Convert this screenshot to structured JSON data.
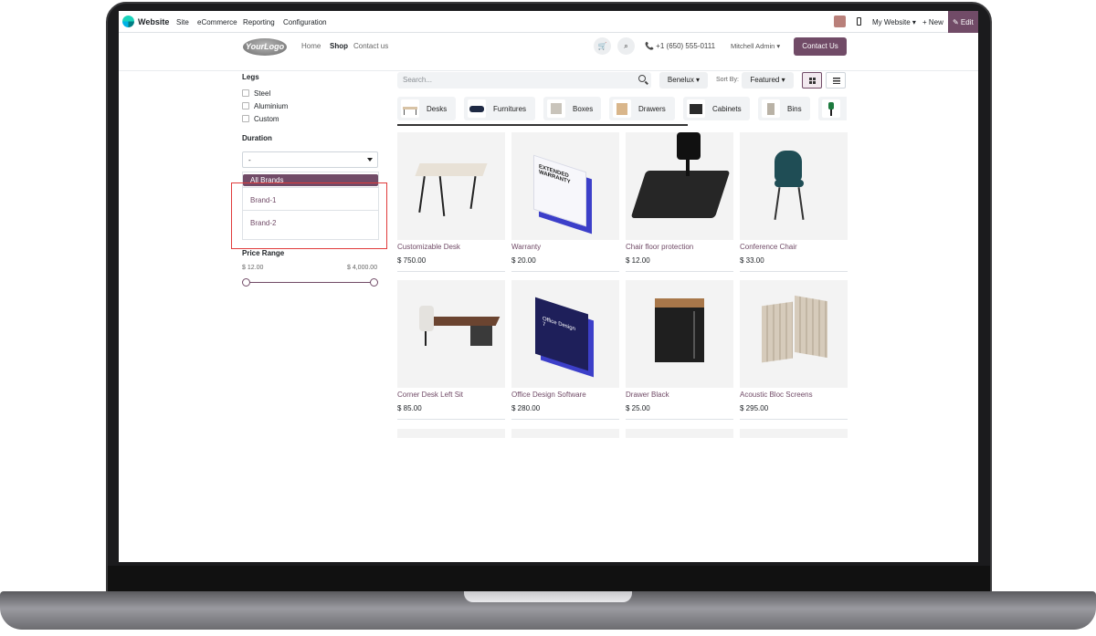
{
  "system_bar": {
    "app_name": "Website",
    "menus": [
      "Site",
      "eCommerce",
      "Reporting",
      "Configuration"
    ],
    "my_website": "My Website ▾",
    "new": "+ New",
    "edit": "✎ Edit"
  },
  "header": {
    "logo": "YourLogo",
    "nav": [
      "Home",
      "Shop",
      "Contact us"
    ],
    "active_nav": "Shop",
    "phone": "📞  +1 (650) 555-0111",
    "user": "Mitchell Admin ▾",
    "cta": "Contact Us"
  },
  "sidebar": {
    "legs_title": "Legs",
    "legs": [
      "Steel",
      "Aluminium",
      "Custom"
    ],
    "duration_title": "Duration",
    "duration_value": "-",
    "brand_options": [
      "All Brands",
      "Brand-1",
      "Brand-2"
    ],
    "brand_selected": "All Brands",
    "price_title": "Price Range",
    "price_min": "$ 12.00",
    "price_max": "$ 4,000.00"
  },
  "toolbar": {
    "search_placeholder": "Search...",
    "pricelist": "Benelux ▾",
    "sort_label": "Sort By:",
    "sort_value": "Featured ▾"
  },
  "categories": [
    "Desks",
    "Furnitures",
    "Boxes",
    "Drawers",
    "Cabinets",
    "Bins"
  ],
  "products": [
    {
      "name": "Customizable Desk",
      "price": "$ 750.00"
    },
    {
      "name": "Warranty",
      "price": "$ 20.00"
    },
    {
      "name": "Chair floor protection",
      "price": "$ 12.00"
    },
    {
      "name": "Conference Chair",
      "price": "$ 33.00"
    },
    {
      "name": "Corner Desk Left Sit",
      "price": "$ 85.00"
    },
    {
      "name": "Office Design Software",
      "price": "$ 280.00"
    },
    {
      "name": "Drawer Black",
      "price": "$ 25.00"
    },
    {
      "name": "Acoustic Bloc Screens",
      "price": "$ 295.00"
    }
  ],
  "product_art": {
    "warranty_box_text": "EXTENDED WARRANTY",
    "software_box_text": "Office Design 7"
  },
  "colors": {
    "brand": "#714b67",
    "highlight": "#e03b3b"
  }
}
